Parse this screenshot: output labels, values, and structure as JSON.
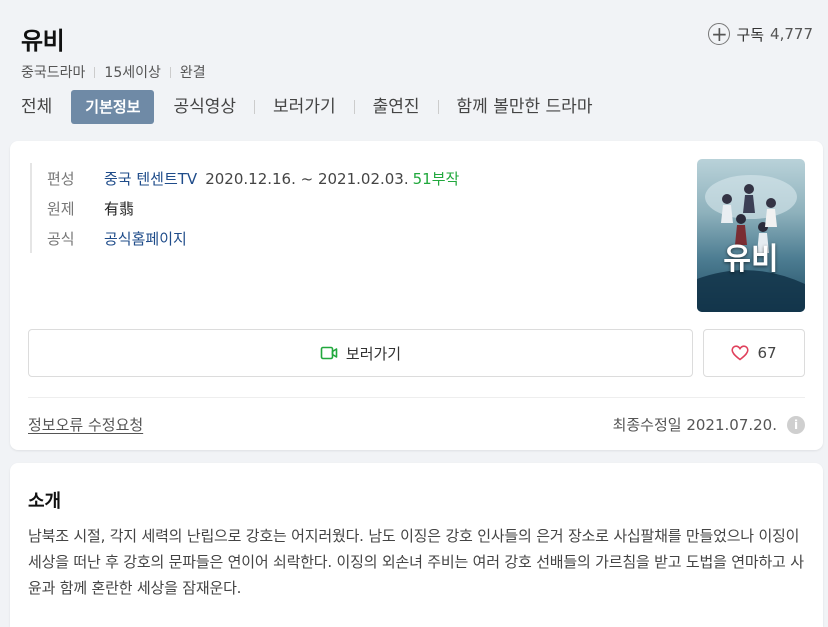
{
  "header": {
    "title": "유비",
    "subscribe_label": "구독",
    "subscribe_count": "4,777",
    "meta": [
      "중국드라마",
      "15세이상",
      "완결"
    ],
    "tabs": [
      {
        "label": "전체",
        "active": false
      },
      {
        "label": "기본정보",
        "active": true
      },
      {
        "label": "공식영상",
        "active": false
      },
      {
        "label": "보러가기",
        "active": false
      },
      {
        "label": "출연진",
        "active": false
      },
      {
        "label": "함께 볼만한 드라마",
        "active": false
      }
    ]
  },
  "info": {
    "broadcast_key": "편성",
    "broadcast_channel": "중국 텐센트TV",
    "broadcast_dates": "2020.12.16. ~ 2021.02.03.",
    "episodes": "51부작",
    "original_key": "원제",
    "original_value": "有翡",
    "official_key": "공식",
    "official_value": "공식홈페이지",
    "poster_title": "유비",
    "poster_icon": "drama-poster"
  },
  "actions": {
    "watch_label": "보러가기",
    "watch_icon": "video-camera-icon",
    "like_count": "67",
    "like_icon": "heart-icon"
  },
  "footer": {
    "report_label": "정보오류 수정요청",
    "updated_label": "최종수정일 2021.07.20.",
    "info_icon": "i"
  },
  "synopsis": {
    "title": "소개",
    "text": "남북조 시절, 각지 세력의 난립으로 강호는 어지러웠다. 남도 이징은 강호 인사들의 은거 장소로 사십팔채를 만들었으나 이징이 세상을 떠난 후 강호의 문파들은 연이어 쇠락한다. 이징의 외손녀 주비는 여러 강호 선배들의 가르침을 받고 도법을 연마하고 사윤과 함께 혼란한 세상을 잠재운다."
  },
  "colors": {
    "accent_tab": "#6f8aa6",
    "link": "#1f4c8a",
    "episodes": "#21a83d",
    "heart": "#e0415c",
    "video_icon": "#21a83d"
  }
}
